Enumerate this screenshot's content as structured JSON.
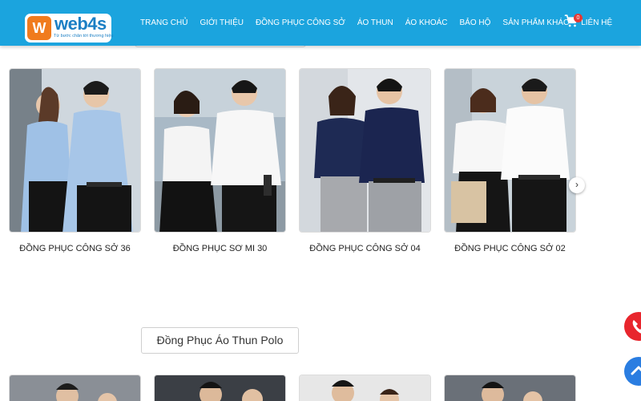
{
  "header": {
    "logo_badge": "W",
    "logo_word": "web4s",
    "logo_sub": "Từ bước chân tới thương hiệu",
    "nav": [
      "TRANG CHỦ",
      "GIỚI THIỆU",
      "ĐỒNG PHỤC CÔNG SỞ",
      "ÁO THUN",
      "ÁO KHOÁC",
      "BẢO HỘ",
      "SẢN PHẨM KHÁC",
      "LIÊN HỆ"
    ],
    "cart_count": "0",
    "cart_icon": "cart-icon"
  },
  "products": [
    {
      "title": "ĐỒNG PHỤC CÔNG SỞ 36",
      "shirt_color": "#9fc1e6",
      "bg": "#cfd7de"
    },
    {
      "title": "ĐỒNG PHỤC SƠ MI 30",
      "shirt_color": "#f4f4f4",
      "bg": "#a9b9c6"
    },
    {
      "title": "ĐỒNG PHỤC CÔNG SỞ 04",
      "shirt_color": "#1e2a54",
      "bg": "#e3e6ea"
    },
    {
      "title": "ĐỒNG PHỤC CÔNG SỞ 02",
      "shirt_color": "#f7f7f7",
      "bg": "#c9d3da"
    }
  ],
  "next_arrow": "›",
  "section_title": "Đồng Phục Áo Thun Polo",
  "bottom_cards": [
    {
      "bg": "#8a8f96"
    },
    {
      "bg": "#3b3f45"
    },
    {
      "bg": "#e7e7e7"
    },
    {
      "bg": "#6a7078"
    }
  ],
  "colors": {
    "header": "#1ba4de",
    "logo_orange": "#f07b1d",
    "phone": "#e8262d",
    "scroll_top": "#2a7de1"
  }
}
